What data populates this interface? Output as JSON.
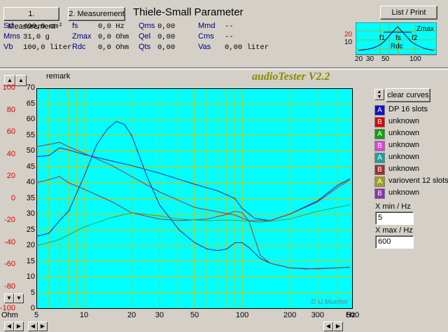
{
  "header": {
    "btn1": "1. Measurement",
    "btn2": "2. Measurement",
    "title": "Thiele-Small Parameter",
    "list_print": "List / Print"
  },
  "params": {
    "col1": [
      {
        "name": "Sd",
        "value": "490,9 cm²"
      },
      {
        "name": "Mms",
        "value": "31,0 g"
      },
      {
        "name": "Vb",
        "value": "100,0 liter"
      }
    ],
    "col2": [
      {
        "name": "fs",
        "value": "0,0 Hz"
      },
      {
        "name": "Zmax",
        "value": "0,0 Ohm"
      },
      {
        "name": "Rdc",
        "value": "0,0 Ohm"
      }
    ],
    "col3": [
      {
        "name": "Qms",
        "value": "0,00"
      },
      {
        "name": "Qel",
        "value": "0,00"
      },
      {
        "name": "Qts",
        "value": "0,00"
      }
    ],
    "col4": [
      {
        "name": "Mmd",
        "value": "--"
      },
      {
        "name": "Cms",
        "value": "--"
      },
      {
        "name": "Vas",
        "value": "0,00 liter"
      }
    ]
  },
  "mini": {
    "zmax": "Zmax",
    "f1": "f1",
    "fs": "fs",
    "f2": "f2",
    "rdc": "Rdc",
    "ticks": [
      "20",
      "30",
      "50",
      "100"
    ]
  },
  "plot": {
    "remark": "remark",
    "app_title": "audioTester V2.2",
    "copyright": "© U.Mueller",
    "ohm": "Ohm",
    "hz": "Hz"
  },
  "controls": {
    "clear": "clear curves",
    "xmin_label": "X min / Hz",
    "xmin": "5",
    "xmax_label": "X max / Hz",
    "xmax": "600"
  },
  "legend": [
    {
      "key": "A",
      "label": "DP 16 slots",
      "color": "#2020c0",
      "bg": "#1010d0",
      "fg": "#ffffff"
    },
    {
      "key": "B",
      "label": "unknown",
      "color": "#e01010",
      "bg": "#e00000",
      "fg": "#ffffff"
    },
    {
      "key": "A",
      "label": "unknown",
      "color": "#10a010",
      "bg": "#10a010",
      "fg": "#ffffff"
    },
    {
      "key": "B",
      "label": "unknown",
      "color": "#e010e0",
      "bg": "#e040e0",
      "fg": "#ffffff"
    },
    {
      "key": "A",
      "label": "unknown",
      "color": "#10a0a0",
      "bg": "#20a0a0",
      "fg": "#ffffff"
    },
    {
      "key": "B",
      "label": "unknown",
      "color": "#a03030",
      "bg": "#a03030",
      "fg": "#ffffff"
    },
    {
      "key": "A",
      "label": "variovent 12 slots",
      "color": "#a0a020",
      "bg": "#a0a020",
      "fg": "#ffffff"
    },
    {
      "key": "B",
      "label": "unknown",
      "color": "#8030a0",
      "bg": "#9030b0",
      "fg": "#ffffff"
    }
  ],
  "chart_data": {
    "type": "line",
    "x_scale": "log",
    "xlim": [
      5,
      500
    ],
    "x_ticks": [
      "5",
      "10",
      "20",
      "30",
      "50",
      "100",
      "200",
      "300",
      "500"
    ],
    "y_left": {
      "label": "Ohm",
      "ticks": [
        "70",
        "65",
        "60",
        "55",
        "50",
        "45",
        "40",
        "35",
        "30",
        "25",
        "20",
        "15",
        "10",
        "5",
        "0"
      ],
      "lim": [
        0,
        70
      ],
      "color": "#000000"
    },
    "y_right_red": {
      "ticks": [
        "100",
        "80",
        "60",
        "40",
        "20",
        "0",
        "-20",
        "-40",
        "-60",
        "-80",
        "-100"
      ],
      "lim": [
        -100,
        100
      ],
      "color": "#e00000"
    },
    "series": [
      {
        "name": "DP 16 slots",
        "axis": "left",
        "color": "#2020c0",
        "points": [
          [
            5,
            23
          ],
          [
            6,
            24
          ],
          [
            7,
            28
          ],
          [
            8,
            31
          ],
          [
            10,
            42
          ],
          [
            12,
            52
          ],
          [
            14,
            57
          ],
          [
            16,
            59.5
          ],
          [
            18,
            58.5
          ],
          [
            20,
            55
          ],
          [
            25,
            42
          ],
          [
            30,
            33
          ],
          [
            40,
            25
          ],
          [
            50,
            21
          ],
          [
            60,
            19
          ],
          [
            70,
            18.5
          ],
          [
            80,
            19
          ],
          [
            90,
            21
          ],
          [
            100,
            21
          ],
          [
            110,
            19.5
          ],
          [
            130,
            16
          ],
          [
            150,
            14.5
          ],
          [
            200,
            13
          ],
          [
            250,
            12.7
          ],
          [
            300,
            12.8
          ],
          [
            400,
            13
          ],
          [
            480,
            13.2
          ]
        ]
      },
      {
        "name": "DP 16 slots phase",
        "axis": "right",
        "color": "#2020c0",
        "points": [
          [
            5,
            38
          ],
          [
            6,
            39
          ],
          [
            7,
            46
          ],
          [
            8,
            44
          ],
          [
            10,
            40
          ],
          [
            15,
            34
          ],
          [
            20,
            30
          ],
          [
            30,
            23
          ],
          [
            50,
            13
          ],
          [
            70,
            7
          ],
          [
            90,
            0
          ],
          [
            100,
            -9
          ],
          [
            120,
            -18
          ],
          [
            150,
            -20
          ],
          [
            200,
            -14
          ],
          [
            300,
            -2
          ],
          [
            400,
            12
          ],
          [
            480,
            18
          ]
        ]
      },
      {
        "name": "unknown",
        "axis": "left",
        "color": "#b03030",
        "points": [
          [
            5,
            40
          ],
          [
            6,
            41
          ],
          [
            7,
            42
          ],
          [
            8,
            40
          ],
          [
            10,
            38
          ],
          [
            15,
            34
          ],
          [
            20,
            30.5
          ],
          [
            30,
            28.5
          ],
          [
            40,
            28
          ],
          [
            60,
            28.5
          ],
          [
            80,
            30
          ],
          [
            90,
            31
          ],
          [
            100,
            30.5
          ],
          [
            110,
            28
          ],
          [
            130,
            17
          ],
          [
            150,
            14.5
          ],
          [
            200,
            13
          ],
          [
            300,
            12.7
          ],
          [
            480,
            13.2
          ]
        ]
      },
      {
        "name": "unknown phase",
        "axis": "right",
        "color": "#b03030",
        "points": [
          [
            5,
            47
          ],
          [
            6,
            49
          ],
          [
            7,
            51
          ],
          [
            8,
            47
          ],
          [
            10,
            41
          ],
          [
            15,
            30
          ],
          [
            20,
            20
          ],
          [
            30,
            6
          ],
          [
            50,
            -8
          ],
          [
            70,
            -12
          ],
          [
            90,
            -15
          ],
          [
            110,
            -20
          ],
          [
            150,
            -20
          ],
          [
            200,
            -14
          ],
          [
            300,
            -3
          ],
          [
            400,
            10
          ],
          [
            480,
            17
          ]
        ]
      },
      {
        "name": "variovent 12 slots",
        "axis": "left",
        "color": "#40a040",
        "points": [
          [
            5,
            20
          ],
          [
            7,
            22
          ],
          [
            10,
            26
          ],
          [
            15,
            29
          ],
          [
            20,
            30.5
          ],
          [
            30,
            29.5
          ],
          [
            40,
            28.5
          ],
          [
            60,
            28
          ],
          [
            80,
            28.2
          ],
          [
            100,
            28
          ],
          [
            130,
            27.5
          ],
          [
            200,
            28.5
          ],
          [
            300,
            31
          ],
          [
            480,
            33
          ]
        ]
      }
    ]
  }
}
